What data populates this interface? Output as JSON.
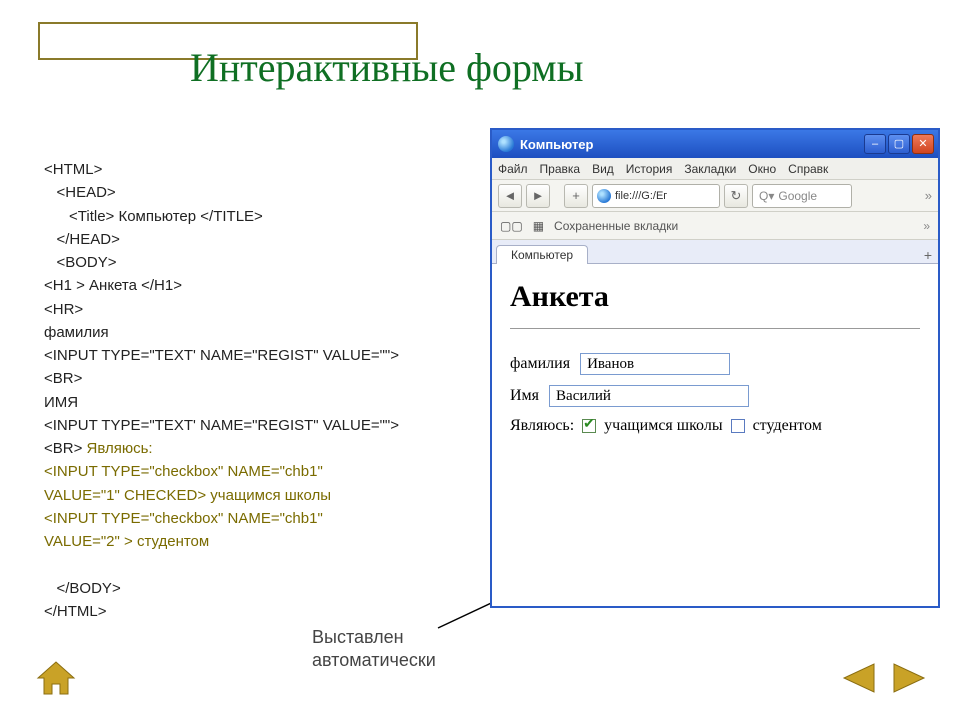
{
  "slide": {
    "title": "Интерактивные формы",
    "caption_line1": "Выставлен",
    "caption_line2": "автоматически"
  },
  "code": {
    "l1": "<HTML>",
    "l2": "   <HEAD>",
    "l3": "      <Title> Компьютер </TITLE>",
    "l4": "   </HEAD>",
    "l5": "   <BODY>",
    "l6": "<H1 > Анкета </H1>",
    "l7": "<HR>",
    "l8": "фамилия",
    "l9": "<INPUT TYPE=\"TEXT' NAME=\"REGIST\" VALUE=\"\">",
    "l10": "<BR>",
    "l11": "ИМЯ",
    "l12": "<INPUT TYPE=\"TEXT' NAME=\"REGIST\" VALUE=\"\">",
    "l13a": "<BR> ",
    "l13b": "Являюсь:",
    "l14": "<INPUT TYPE=\"checkbox\" NAME=\"chb1\"",
    "l15a": "VALUE=\"1\" CHECKED> ",
    "l15b": "учащимся школы",
    "l16": "<INPUT TYPE=\"checkbox\" NAME=\"chb1\"",
    "l17a": "VALUE=\"2\" > ",
    "l17b": "студентом",
    "l18": " ",
    "l19": "   </BODY>",
    "l20": "</HTML>"
  },
  "browser": {
    "window_title": "Компьютер",
    "menu": [
      "Файл",
      "Правка",
      "Вид",
      "История",
      "Закладки",
      "Окно",
      "Справк"
    ],
    "url": "file:///G:/Ег",
    "search_prefix": "Q▾",
    "search_placeholder": "Google",
    "bookmarks_label": "Сохраненные вкладки",
    "tab_label": "Компьютер",
    "nav": {
      "plus": "+",
      "reload": "↻",
      "overflow": "»"
    }
  },
  "page": {
    "heading": "Анкета",
    "surname_label": "фамилия",
    "surname_value": "Иванов",
    "name_label": "Имя",
    "name_value": "Василий",
    "iam_label": "Являюсь:",
    "opt1": "учащимся школы",
    "opt2": "студентом"
  }
}
